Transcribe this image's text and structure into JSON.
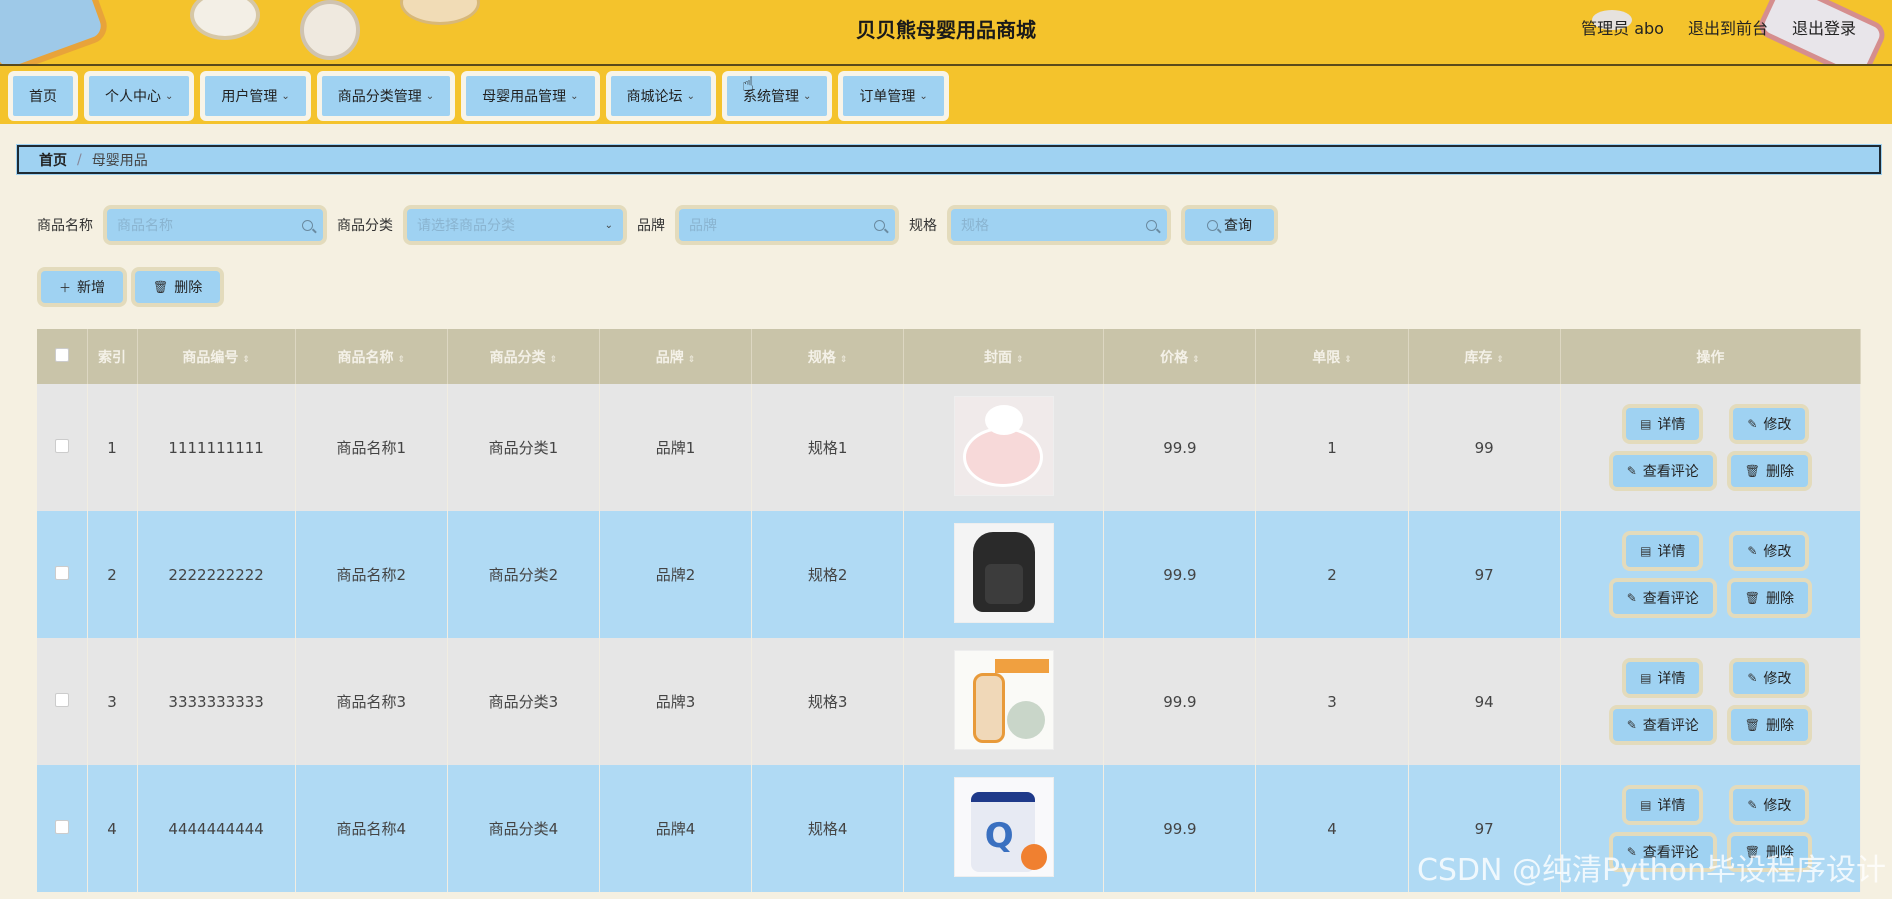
{
  "header": {
    "title": "贝贝熊母婴用品商城",
    "links": [
      "管理员 abo",
      "退出到前台",
      "退出登录"
    ]
  },
  "nav": [
    "首页",
    "个人中心",
    "用户管理",
    "商品分类管理",
    "母婴用品管理",
    "商城论坛",
    "系统管理",
    "订单管理"
  ],
  "breadcrumb": {
    "home": "首页",
    "current": "母婴用品"
  },
  "search": {
    "name_label": "商品名称",
    "name_placeholder": "商品名称",
    "category_label": "商品分类",
    "category_placeholder": "请选择商品分类",
    "brand_label": "品牌",
    "brand_placeholder": "品牌",
    "spec_label": "规格",
    "spec_placeholder": "规格",
    "query_label": "查询"
  },
  "actions": {
    "add": "新增",
    "delete": "删除"
  },
  "table": {
    "headers": [
      "索引",
      "商品编号",
      "商品名称",
      "商品分类",
      "品牌",
      "规格",
      "封面",
      "价格",
      "单限",
      "库存",
      "操作"
    ],
    "rows": [
      {
        "index": "1",
        "code": "1111111111",
        "name": "商品名称1",
        "category": "商品分类1",
        "brand": "品牌1",
        "spec": "规格1",
        "price": "99.9",
        "limit": "1",
        "stock": "99"
      },
      {
        "index": "2",
        "code": "2222222222",
        "name": "商品名称2",
        "category": "商品分类2",
        "brand": "品牌2",
        "spec": "规格2",
        "price": "99.9",
        "limit": "2",
        "stock": "97"
      },
      {
        "index": "3",
        "code": "3333333333",
        "name": "商品名称3",
        "category": "商品分类3",
        "brand": "品牌3",
        "spec": "规格3",
        "price": "99.9",
        "limit": "3",
        "stock": "94"
      },
      {
        "index": "4",
        "code": "4444444444",
        "name": "商品名称4",
        "category": "商品分类4",
        "brand": "品牌4",
        "spec": "规格4",
        "price": "99.9",
        "limit": "4",
        "stock": "97"
      }
    ],
    "ops": {
      "detail": "详情",
      "edit": "修改",
      "comments": "查看评论",
      "delete": "删除"
    }
  },
  "watermark": "CSDN @纯清Python毕设程序设计"
}
